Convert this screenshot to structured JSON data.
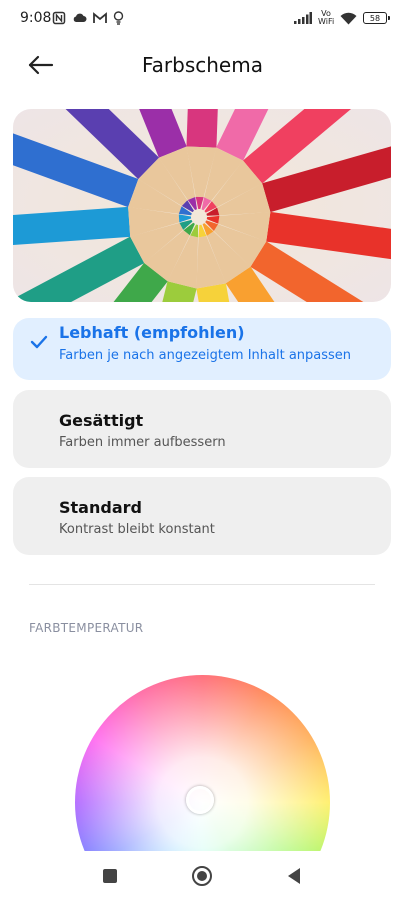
{
  "status_bar": {
    "time": "9:08",
    "vowifi_top": "Vo",
    "vowifi_bottom": "WiFi",
    "battery": "58"
  },
  "header": {
    "title": "Farbschema",
    "back_icon": "arrow-left-icon"
  },
  "options": [
    {
      "title": "Lebhaft (empfohlen)",
      "subtitle": "Farben je nach angezeigtem Inhalt anpassen",
      "selected": true
    },
    {
      "title": "Gesättigt",
      "subtitle": "Farben immer aufbessern",
      "selected": false
    },
    {
      "title": "Standard",
      "subtitle": "Kontrast bleibt konstant",
      "selected": false
    }
  ],
  "section": {
    "color_temperature_label": "FARBTEMPERATUR"
  },
  "colors": {
    "accent": "#1a73e8",
    "selected_bg": "#e1efff",
    "option_bg": "#efefef"
  },
  "nav": {
    "recents_icon": "square-icon",
    "home_icon": "circle-home-icon",
    "back_icon": "triangle-back-icon"
  }
}
